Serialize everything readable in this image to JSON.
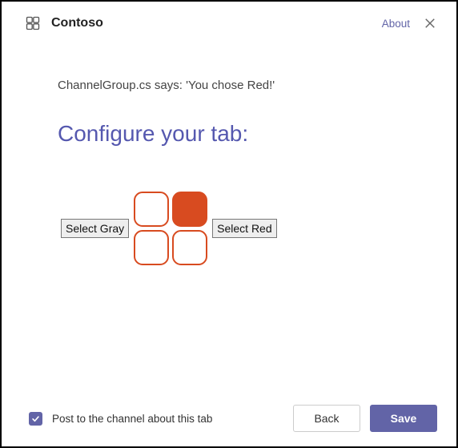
{
  "header": {
    "app_name": "Contoso",
    "about_label": "About"
  },
  "content": {
    "message": "ChannelGroup.cs says: 'You chose Red!'",
    "heading": "Configure your tab:",
    "select_gray_label": "Select Gray",
    "select_red_label": "Select Red"
  },
  "footer": {
    "post_label": "Post to the channel about this tab",
    "back_label": "Back",
    "save_label": "Save",
    "post_checked": true
  },
  "colors": {
    "accent": "#6264A7",
    "tile": "#D84B20"
  }
}
